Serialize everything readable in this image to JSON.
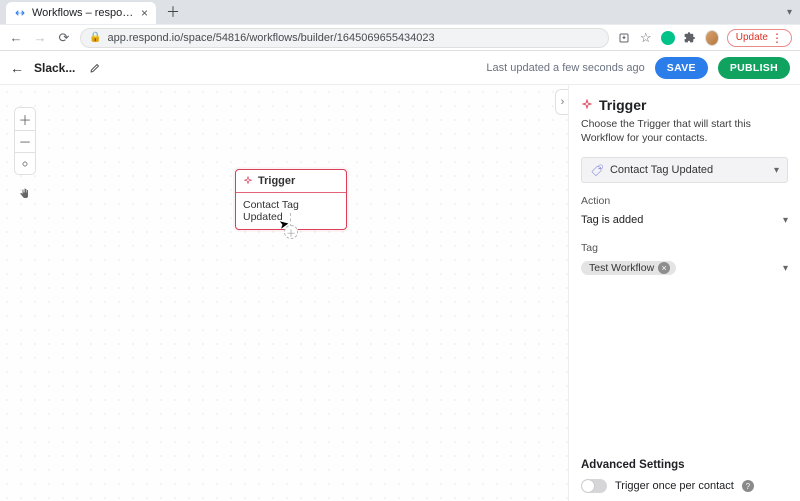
{
  "browser": {
    "tab_title": "Workflows – respond.io",
    "url": "app.respond.io/space/54816/workflows/builder/1645069655434023",
    "update_label": "Update"
  },
  "appbar": {
    "workflow_name": "Slack...",
    "last_updated": "Last updated a few seconds ago",
    "save_label": "SAVE",
    "publish_label": "PUBLISH"
  },
  "canvas": {
    "node_title": "Trigger",
    "node_subtitle": "Contact Tag Updated"
  },
  "panel": {
    "title": "Trigger",
    "description": "Choose the Trigger that will start this Workflow for your contacts.",
    "trigger_selected": "Contact Tag Updated",
    "action_label": "Action",
    "action_value": "Tag is added",
    "tag_label": "Tag",
    "tag_chip": "Test Workflow",
    "advanced_title": "Advanced Settings",
    "toggle_label": "Trigger once per contact"
  }
}
